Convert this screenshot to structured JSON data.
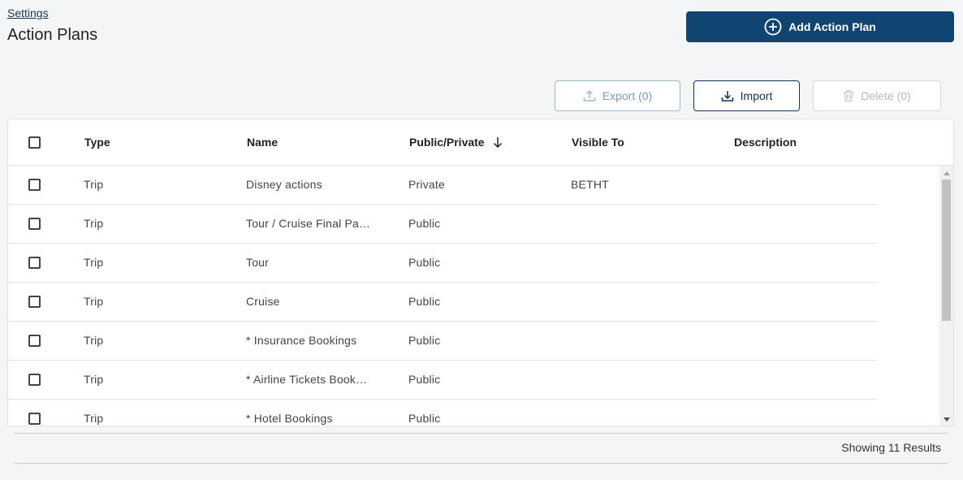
{
  "breadcrumb": "Settings",
  "title": "Action Plans",
  "add_button": "Add Action Plan",
  "toolbar": {
    "export": "Export (0)",
    "import": "Import",
    "delete": "Delete (0)"
  },
  "columns": {
    "type": "Type",
    "name": "Name",
    "public_private": "Public/Private",
    "visible_to": "Visible To",
    "description": "Description"
  },
  "rows": [
    {
      "type": "Trip",
      "name": "Disney actions",
      "public_private": "Private",
      "visible_to": "BETHT",
      "description": ""
    },
    {
      "type": "Trip",
      "name": "Tour / Cruise Final Pa…",
      "public_private": "Public",
      "visible_to": "",
      "description": ""
    },
    {
      "type": "Trip",
      "name": "Tour",
      "public_private": "Public",
      "visible_to": "",
      "description": ""
    },
    {
      "type": "Trip",
      "name": "Cruise",
      "public_private": "Public",
      "visible_to": "",
      "description": ""
    },
    {
      "type": "Trip",
      "name": "* Insurance Bookings",
      "public_private": "Public",
      "visible_to": "",
      "description": ""
    },
    {
      "type": "Trip",
      "name": "* Airline Tickets Book…",
      "public_private": "Public",
      "visible_to": "",
      "description": ""
    },
    {
      "type": "Trip",
      "name": "* Hotel Bookings",
      "public_private": "Public",
      "visible_to": "",
      "description": ""
    }
  ],
  "results_text": "Showing 11 Results",
  "colors": {
    "primary": "#0f4570",
    "background": "#f4f5f7"
  },
  "icons": {
    "add": "plus-circle-icon",
    "export": "upload-icon",
    "import": "download-icon",
    "delete": "trash-icon",
    "sort": "arrow-down-icon"
  }
}
